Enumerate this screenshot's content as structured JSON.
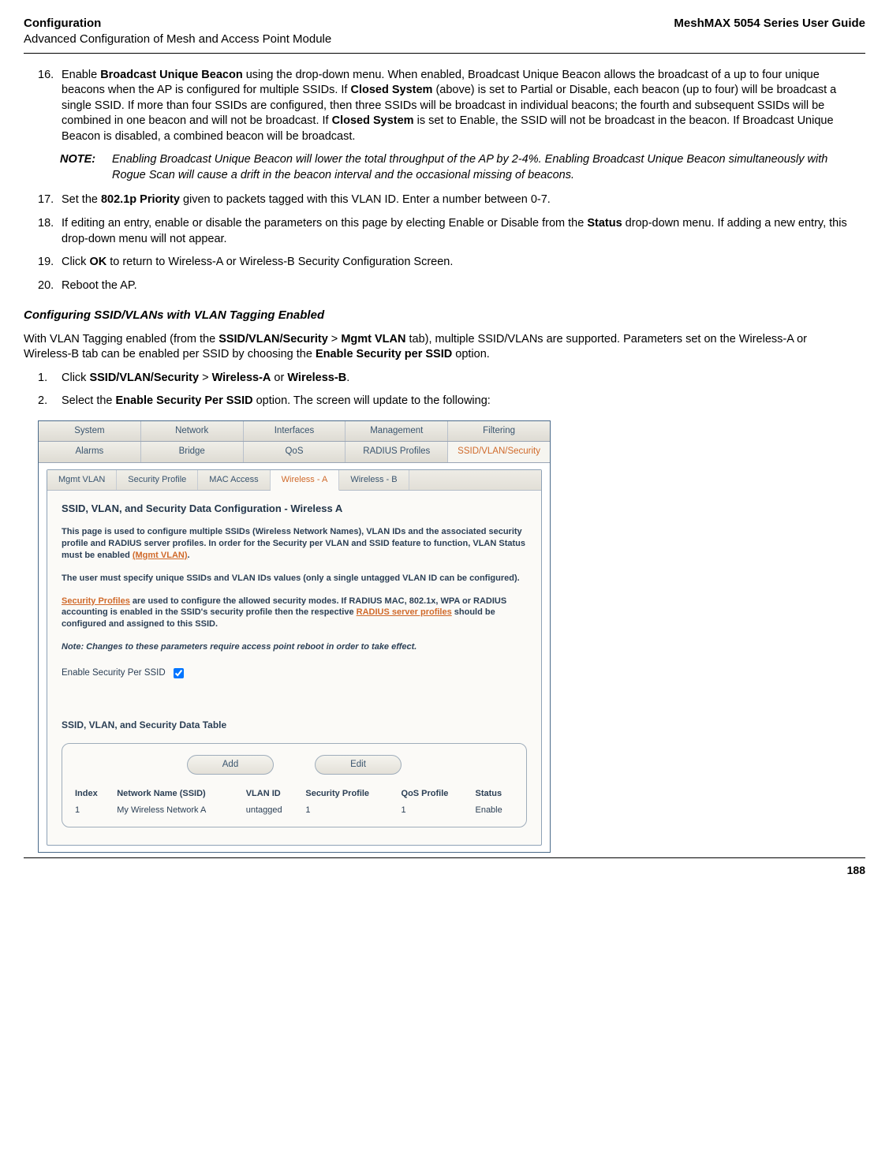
{
  "header": {
    "left_title": "Configuration",
    "left_subtitle": "Advanced Configuration of Mesh and Access Point Module",
    "right_title": "MeshMAX 5054 Series User Guide"
  },
  "footer": {
    "page_number": "188"
  },
  "steps_a": {
    "s16": {
      "num": "16.",
      "pre": "Enable ",
      "bold1": "Broadcast Unique Beacon",
      "mid1": " using the drop-down menu. When enabled, Broadcast Unique Beacon allows the broadcast of a up to four unique beacons when the AP is configured for multiple SSIDs. If ",
      "bold2": "Closed System",
      "mid2": " (above) is set to Partial or Disable, each beacon (up to four) will be broadcast a single SSID. If more than four SSIDs are configured, then three SSIDs will be broadcast in individual beacons; the fourth and subsequent SSIDs will be combined in one beacon and will not be broadcast. If ",
      "bold3": "Closed System",
      "mid3": " is set to Enable, the SSID will not be broadcast in the beacon. If Broadcast Unique Beacon is disabled, a combined beacon will be broadcast."
    },
    "note": {
      "label": "NOTE:",
      "text": "Enabling Broadcast Unique Beacon will lower the total throughput of the AP by 2-4%. Enabling Broadcast Unique Beacon simultaneously with Rogue Scan will cause a drift in the beacon interval and the occasional missing of beacons."
    },
    "s17": {
      "num": "17.",
      "pre": "Set the ",
      "bold1": "802.1p Priority",
      "post": " given to packets tagged with this VLAN ID. Enter a number between 0-7."
    },
    "s18": {
      "num": "18.",
      "pre": "If editing an entry, enable or disable the parameters on this page by electing Enable or Disable from the ",
      "bold1": "Status",
      "post": " drop-down menu. If adding a new entry, this drop-down menu will not appear."
    },
    "s19": {
      "num": "19.",
      "pre": "Click ",
      "bold1": "OK",
      "post": " to return to Wireless-A or Wireless-B Security Configuration Screen."
    },
    "s20": {
      "num": "20.",
      "text": "Reboot the AP."
    }
  },
  "section": {
    "heading": "Configuring SSID/VLANs with VLAN Tagging Enabled",
    "para": {
      "pre": "With VLAN Tagging enabled (from the ",
      "bold1": "SSID/VLAN/Security",
      "mid1": " > ",
      "bold2": "Mgmt VLAN",
      "mid2": " tab), multiple SSID/VLANs are supported. Parameters set on the Wireless-A or Wireless-B tab can be enabled per SSID by choosing the ",
      "bold3": "Enable Security per SSID",
      "post": " option."
    },
    "steps": {
      "s1": {
        "num": "1.",
        "pre": "Click ",
        "bold1": "SSID/VLAN/Security",
        "mid1": " > ",
        "bold2": "Wireless-A",
        "mid2": " or ",
        "bold3": "Wireless-B",
        "post": "."
      },
      "s2": {
        "num": "2.",
        "pre": "Select the ",
        "bold1": "Enable Security Per SSID",
        "post": " option. The screen will update to the following:"
      }
    }
  },
  "shot": {
    "outer_tabs_row1": [
      "System",
      "Network",
      "Interfaces",
      "Management",
      "Filtering"
    ],
    "outer_tabs_row2": {
      "items": [
        "Alarms",
        "Bridge",
        "QoS",
        "RADIUS Profiles",
        "SSID/VLAN/Security"
      ],
      "active_index": 4
    },
    "inner_tabs": {
      "items": [
        "Mgmt VLAN",
        "Security Profile",
        "MAC Access",
        "Wireless - A",
        "Wireless - B"
      ],
      "active_index": 3
    },
    "panel": {
      "title": "SSID, VLAN, and Security Data Configuration - Wireless A",
      "p1_pre": "This page is used to configure multiple SSIDs (Wireless Network Names), VLAN IDs and the associated security profile and RADIUS server profiles. In order for the Security per VLAN and SSID feature to function, VLAN Status must be enabled ",
      "p1_link": "(Mgmt VLAN)",
      "p1_post": ".",
      "p2": "The user must specify unique SSIDs and VLAN IDs values (only a single untagged VLAN ID can be configured).",
      "p3_link1": "Security Profiles",
      "p3_mid": " are used to configure the allowed security modes. If RADIUS MAC, 802.1x, WPA or RADIUS accounting is enabled in the SSID's security profile then the respective ",
      "p3_link2": "RADIUS server profiles",
      "p3_post": " should be configured and assigned to this SSID.",
      "note": "Note: Changes to these parameters require access point reboot in order to take effect.",
      "enable_label": "Enable Security Per SSID",
      "enable_checked": true,
      "table_title": "SSID, VLAN, and Security Data Table",
      "buttons": {
        "add": "Add",
        "edit": "Edit"
      },
      "columns": [
        "Index",
        "Network Name (SSID)",
        "VLAN ID",
        "Security Profile",
        "QoS Profile",
        "Status"
      ],
      "rows": [
        {
          "index": "1",
          "ssid": "My Wireless Network A",
          "vlan": "untagged",
          "sec": "1",
          "qos": "1",
          "status": "Enable"
        }
      ]
    }
  }
}
